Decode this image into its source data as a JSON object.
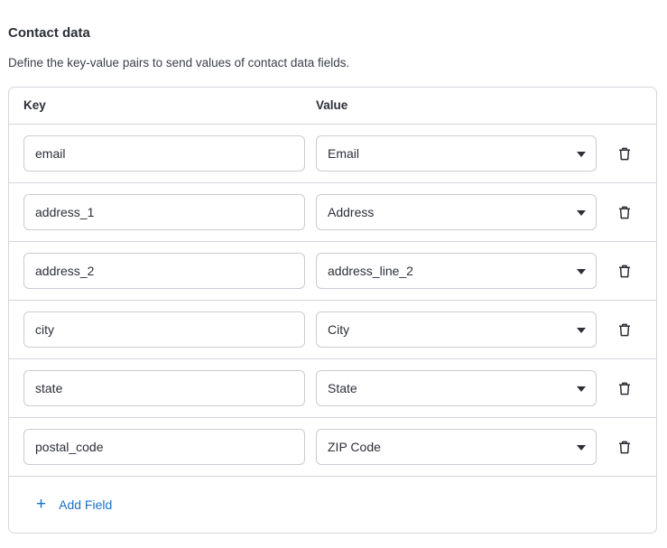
{
  "section": {
    "title": "Contact data",
    "description": "Define the key-value pairs to send values of contact data fields."
  },
  "table": {
    "key_header": "Key",
    "value_header": "Value",
    "rows": [
      {
        "key": "email",
        "value": "Email"
      },
      {
        "key": "address_1",
        "value": "Address"
      },
      {
        "key": "address_2",
        "value": "address_line_2"
      },
      {
        "key": "city",
        "value": "City"
      },
      {
        "key": "state",
        "value": "State"
      },
      {
        "key": "postal_code",
        "value": "ZIP Code"
      }
    ],
    "delete_icon": "trash-icon",
    "dropdown_icon": "caret-down-icon"
  },
  "actions": {
    "add_field_label": "Add Field",
    "add_icon": "plus-icon"
  },
  "colors": {
    "accent": "#1a6fc6",
    "border": "#d4d7dd",
    "text": "#2b2f38"
  }
}
